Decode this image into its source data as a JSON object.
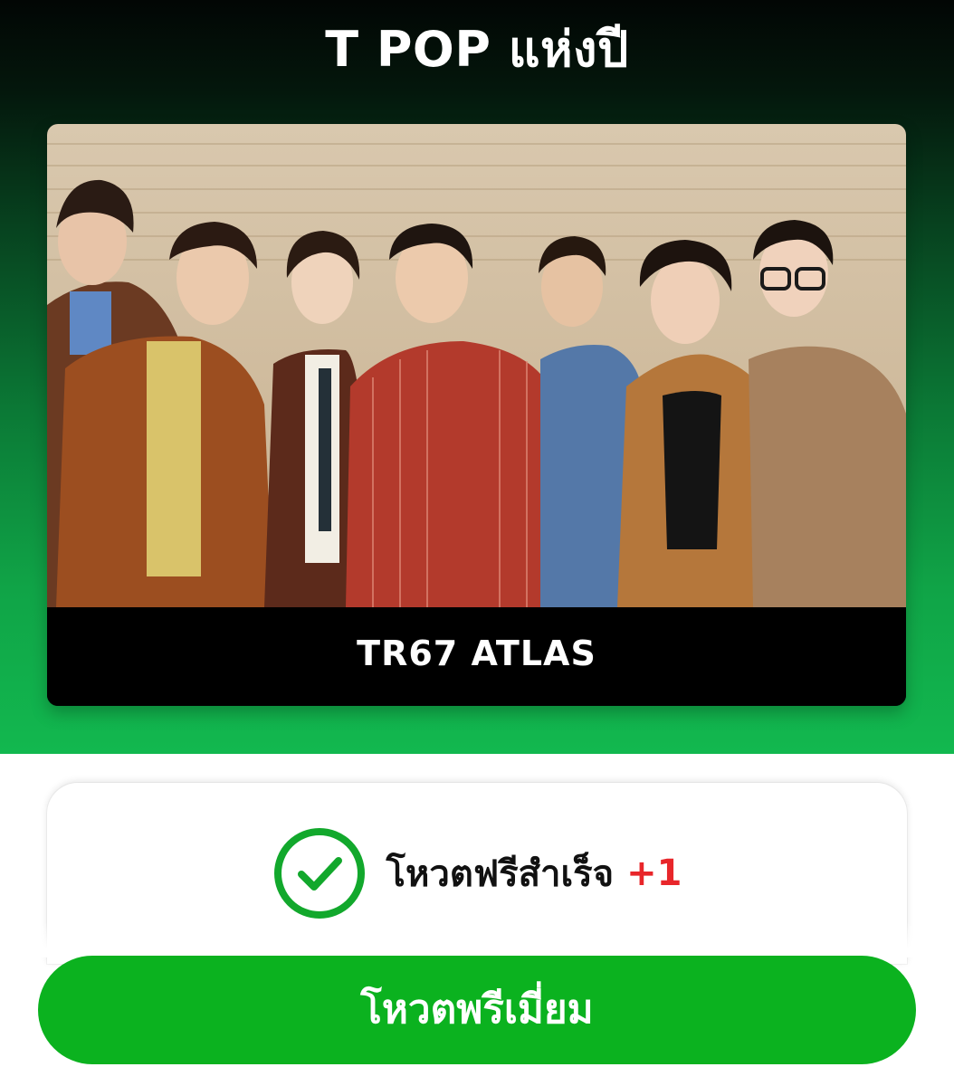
{
  "header": {
    "title": "T POP แห่งปี"
  },
  "artist_card": {
    "name": "TR67 ATLAS",
    "photo_icon": "group-photo"
  },
  "vote_result": {
    "icon": "check-circle-icon",
    "message": "โหวตฟรีสำเร็จ",
    "bonus": "+1"
  },
  "actions": {
    "premium_vote_label": "โหวตพรีเมี่ยม"
  },
  "colors": {
    "brand_green": "#0bb21f",
    "check_green": "#12a82c",
    "bonus_red": "#e8262a"
  }
}
